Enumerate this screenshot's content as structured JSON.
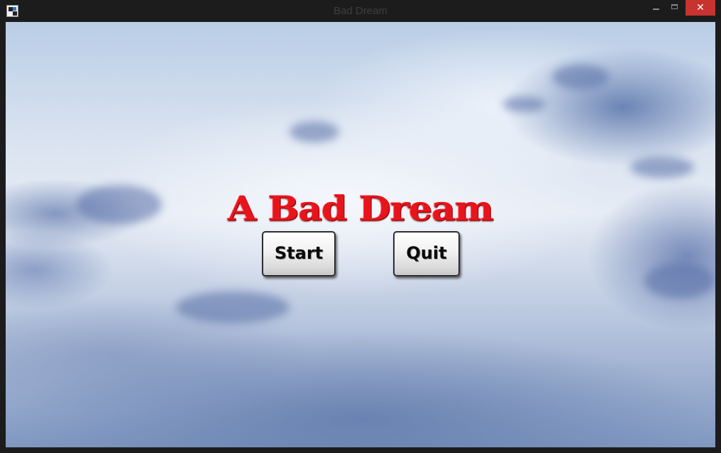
{
  "window": {
    "title": "Bad Dream",
    "icon": "app-icon",
    "controls": {
      "minimize_icon": "minimize-icon",
      "maximize_icon": "maximize-icon",
      "close_symbol": "✕",
      "close_color": "#c7332f"
    }
  },
  "game": {
    "title": "A Bad Dream",
    "title_color": "#e8141c",
    "background": "cloudy-sky",
    "menu": {
      "start_label": "Start",
      "quit_label": "Quit"
    }
  }
}
